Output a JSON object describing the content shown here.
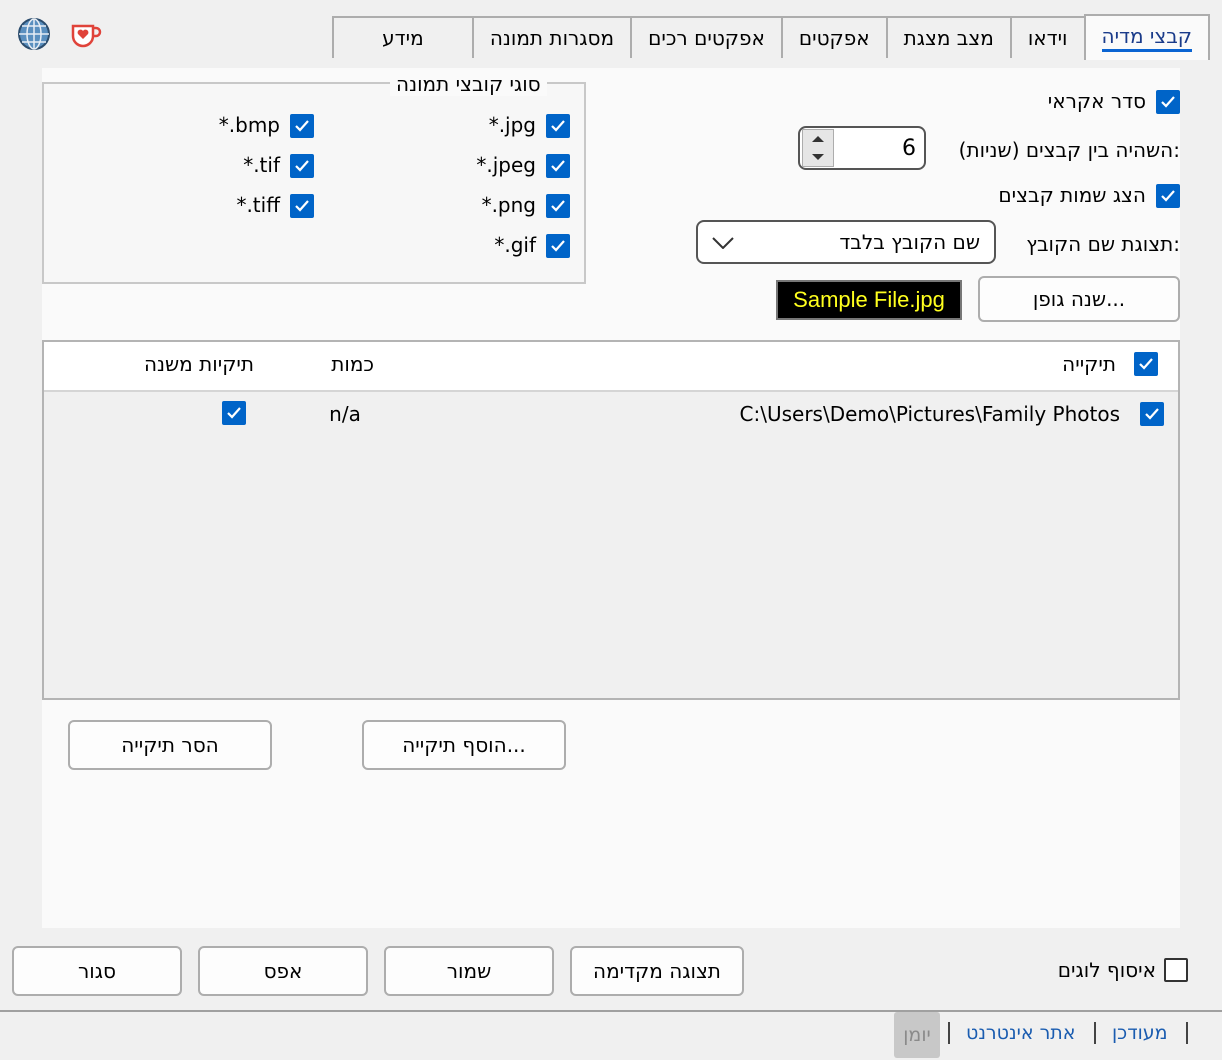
{
  "tabs": [
    "קבצי מדיה",
    "וידאו",
    "מצב מצגת",
    "אפקטים",
    "אפקטים רכים",
    "מסגרות תמונה",
    "מידע"
  ],
  "settings": {
    "random_order_label": "סדר אקראי",
    "delay_label": "השהיה בין קבצים (שניות):",
    "delay_value": "6",
    "show_names_label": "הצג שמות קבצים",
    "name_display_label": "תצוגת שם הקובץ:",
    "name_display_value": "שם הקובץ בלבד",
    "change_font_button": "שנה גופן...",
    "font_sample": "Sample File.jpg"
  },
  "file_types": {
    "title": "סוגי קובצי תמונה",
    "items": [
      "*.jpg",
      "*.jpeg",
      "*.png",
      "*.gif",
      "*.bmp",
      "*.tif",
      "*.tiff"
    ]
  },
  "folders": {
    "columns": [
      "תיקייה",
      "כמות",
      "תיקיות משנה"
    ],
    "rows": [
      {
        "path": "C:\\Users\\Demo\\Pictures\\Family Photos",
        "count": "n/a"
      }
    ],
    "add_button": "הוסף תיקייה...",
    "remove_button": "הסר תיקייה"
  },
  "bottom": {
    "collect_logs_label": "איסוף לוגים",
    "preview_button": "תצוגה מקדימה",
    "save_button": "שמור",
    "reset_button": "אפס",
    "close_button": "סגור"
  },
  "footer": {
    "log_button": "יומן",
    "website_link": "אתר אינטרנט",
    "updated_link": "מעודכן"
  },
  "colors": {
    "accent": "#0064c8",
    "sample_bg": "#000000",
    "sample_fg": "#ffff1e"
  }
}
